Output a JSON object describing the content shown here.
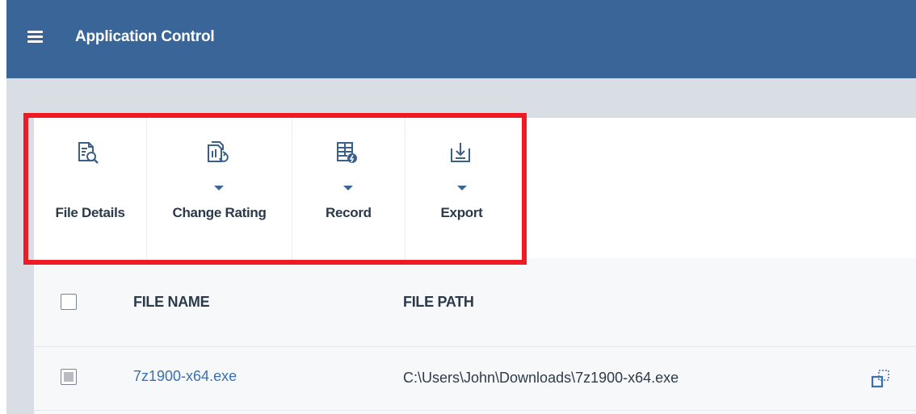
{
  "header": {
    "title": "Application Control",
    "menu_icon": "hamburger-menu-icon",
    "color": "#3a6598"
  },
  "toolbar": {
    "items": [
      {
        "label": "File Details",
        "icon": "file-details-icon",
        "has_dropdown": false
      },
      {
        "label": "Change Rating",
        "icon": "change-rating-icon",
        "has_dropdown": true
      },
      {
        "label": "Record",
        "icon": "record-icon",
        "has_dropdown": true
      },
      {
        "label": "Export",
        "icon": "export-icon",
        "has_dropdown": true
      }
    ],
    "highlight_color": "#ee1b24"
  },
  "table": {
    "columns": [
      "FILE NAME",
      "FILE PATH"
    ],
    "rows": [
      {
        "file_name": "7z1900-x64.exe",
        "file_path": "C:\\Users\\John\\Downloads\\7z1900-x64.exe",
        "icon": "expand-details-icon"
      }
    ]
  }
}
